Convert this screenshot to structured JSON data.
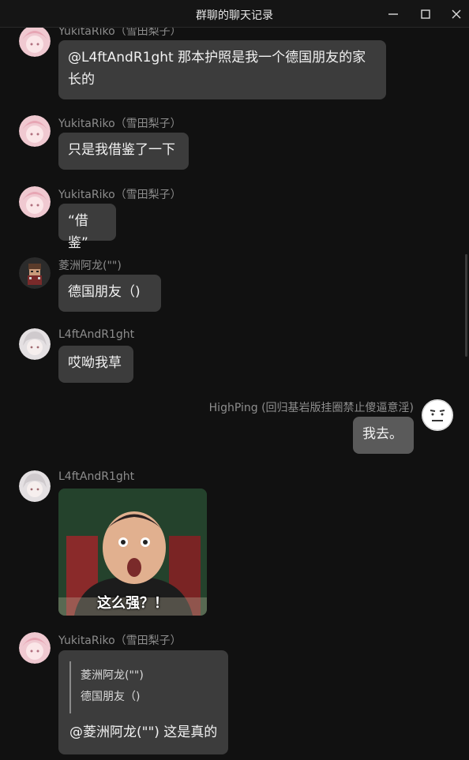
{
  "window": {
    "title": "群聊的聊天记录",
    "controls": [
      "minimize-icon",
      "maximize-icon",
      "close-icon"
    ]
  },
  "messages": [
    {
      "sender": "YukitaRiko（雪田梨子）",
      "text": "@L4ftAndR1ght 那本护照是我一个德国朋友的家长的",
      "avatar": "pink-anime-avatar"
    },
    {
      "sender": "YukitaRiko（雪田梨子）",
      "text": "只是我借鉴了一下",
      "avatar": "pink-anime-avatar"
    },
    {
      "sender": "YukitaRiko（雪田梨子）",
      "text": "“借鉴”",
      "avatar": "pink-anime-avatar"
    },
    {
      "sender": "菱洲阿龙(\"\")",
      "text": "德国朋友（)",
      "avatar": "pixel-character-avatar"
    },
    {
      "sender": "L4ftAndR1ght",
      "text": "哎呦我草",
      "avatar": "white-hair-anime-avatar"
    },
    {
      "sender": "HighPing (回归基岩版挂圈禁止傻逼意淫)",
      "text": "我去。",
      "avatar": "meh-face-avatar",
      "self": true
    },
    {
      "sender": "L4ftAndR1ght",
      "image_caption": "这么强？！",
      "image_icon": "meme-face-image",
      "avatar": "white-hair-anime-avatar"
    },
    {
      "sender": "YukitaRiko（雪田梨子）",
      "quote": {
        "sender": "菱洲阿龙(\"\")",
        "text": "德国朋友（)"
      },
      "text": "@菱洲阿龙(\"\") 这是真的",
      "avatar": "pink-anime-avatar"
    }
  ]
}
